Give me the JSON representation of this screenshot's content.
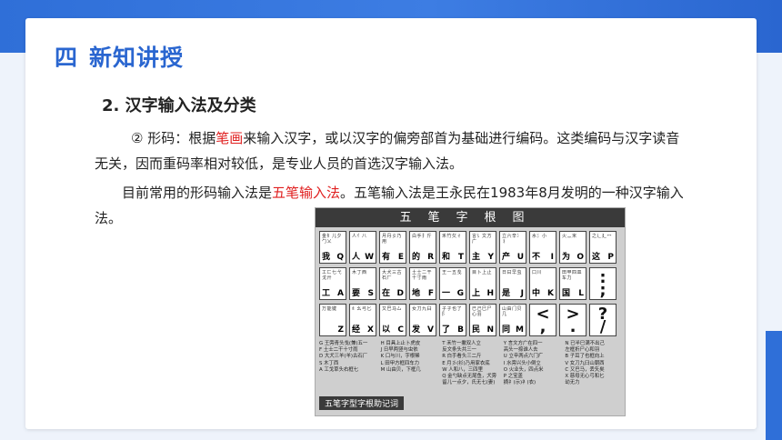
{
  "section": {
    "number": "四",
    "title": "新知讲授"
  },
  "subsection": {
    "label": "2.  汉字输入法及分类"
  },
  "paragraph1": {
    "prefix": "② 形码：根据",
    "highlight": "笔画",
    "suffix": "来输入汉字，或以汉字的偏旁部首为基础进行编码。这类编码与汉字读音无关，因而重码率相对较低，是专业人员的首选汉字输入法。"
  },
  "paragraph2": {
    "prefix": "目前常用的形码输入法是",
    "highlight": "五笔输入法",
    "suffix": "。五笔输入法是王永民在1983年8月发明的一种汉字输入法。"
  },
  "keyboard": {
    "title": "五笔字根图",
    "footer": "五笔字型字根助记词",
    "row1": [
      {
        "roots": "金钅儿夕勹乂",
        "char": "我",
        "key": "Q"
      },
      {
        "roots": "人亻八",
        "char": "人",
        "key": "W"
      },
      {
        "roots": "月丹彡乃用",
        "char": "有",
        "key": "E"
      },
      {
        "roots": "白手扌斤",
        "char": "的",
        "key": "R"
      },
      {
        "roots": "禾竹攵彳",
        "char": "和",
        "key": "T"
      },
      {
        "roots": "言讠文方广",
        "char": "主",
        "key": "Y"
      },
      {
        "roots": "立六辛冫丬",
        "char": "产",
        "key": "U"
      },
      {
        "roots": "水氵小",
        "char": "不",
        "key": "I"
      },
      {
        "roots": "火灬米",
        "char": "为",
        "key": "O"
      },
      {
        "roots": "之辶廴冖",
        "char": "这",
        "key": "P"
      }
    ],
    "row2": [
      {
        "roots": "工匚七弋戈廾",
        "char": "工",
        "key": "A"
      },
      {
        "roots": "木丁西",
        "char": "要",
        "key": "S"
      },
      {
        "roots": "大犬三古石厂",
        "char": "在",
        "key": "D"
      },
      {
        "roots": "土士二干十寸雨",
        "char": "地",
        "key": "F"
      },
      {
        "roots": "王一五戋",
        "char": "一",
        "key": "G"
      },
      {
        "roots": "目卜上止",
        "char": "上",
        "key": "H"
      },
      {
        "roots": "日曰早虫",
        "char": "是",
        "key": "J"
      },
      {
        "roots": "口川",
        "char": "中",
        "key": "K"
      },
      {
        "roots": "田甲四皿车力",
        "char": "国",
        "key": "L"
      },
      {
        "roots": "",
        "char": "",
        "key": "；",
        "symbol": ":\n;"
      }
    ],
    "row3": [
      {
        "roots": "万能键",
        "char": "",
        "key": "Z"
      },
      {
        "roots": "纟幺弓匕",
        "char": "经",
        "key": "X"
      },
      {
        "roots": "又巴马厶",
        "char": "以",
        "key": "C"
      },
      {
        "roots": "女刀九臼",
        "char": "发",
        "key": "V"
      },
      {
        "roots": "子孑也了阝",
        "char": "了",
        "key": "B"
      },
      {
        "roots": "已己巳尸心羽",
        "char": "民",
        "key": "N"
      },
      {
        "roots": "山由门贝几",
        "char": "同",
        "key": "M"
      },
      {
        "roots": "",
        "char": "",
        "key": "，",
        "symbol": "<\n,"
      },
      {
        "roots": "",
        "char": "",
        "key": "。",
        "symbol": ">\n."
      },
      {
        "roots": "",
        "char": "",
        "key": "/",
        "symbol": "?\n/"
      }
    ],
    "mnemonic_col1": [
      "G 王旁青头戋(兼)五一",
      "F 土士二干十寸雨",
      "D 大犬三羊(羊)古石厂",
      "S 木丁西",
      "A 工戈草头右框七"
    ],
    "mnemonic_col2": [
      "H 目具上止卜虎皮",
      "J 日早两竖与虫依",
      "K 口与川，字根稀",
      "L 田甲方框四车力",
      "M 山由贝，下框几"
    ],
    "mnemonic_col3": [
      "T 禾竹一撇双人立",
      "  反文条头共三一",
      "R 白手看头三二斤",
      "E 月彡(衫)乃用家衣底",
      "W 人和八，三四里",
      "Q 金勺缺点无尾鱼，犬旁",
      "  留儿一点夕，氏无七(妻)"
    ],
    "mnemonic_col4": [
      "Y 言文方广在四一",
      "  高头一捺谁人去",
      "U 立辛两点六门疒",
      "I 水旁兴头小倒立",
      "O 火业头，四点米",
      "P 之宝盖",
      "  摘礻(示)衤(衣)"
    ],
    "mnemonic_col5": [
      "N 已半巳满不出己",
      "  左框折尸心和羽",
      "B 子耳了也框向上",
      "V 女刀九臼山朝西",
      "C 又巴马，丢矢矣",
      "X 慈母无心弓和匕",
      "  幼无力"
    ]
  }
}
